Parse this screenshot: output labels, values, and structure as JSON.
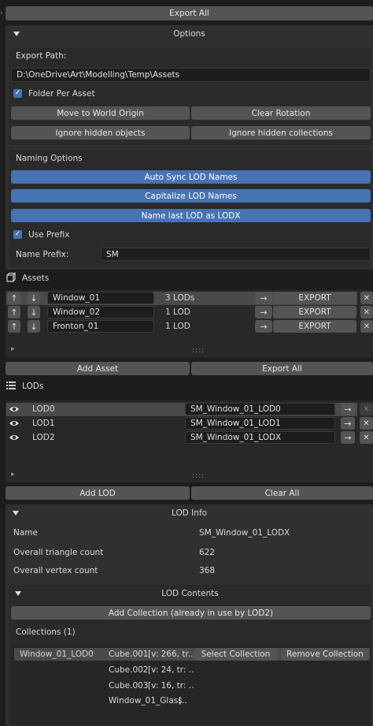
{
  "top": {
    "export_all": "Export All"
  },
  "options": {
    "title": "Options",
    "export_path_label": "Export Path:",
    "export_path_value": "D:\\OneDrive\\Art\\Modelling\\Temp\\Assets",
    "folder_per_asset": "Folder Per Asset",
    "move_to_world_origin": "Move to World Origin",
    "clear_rotation": "Clear Rotation",
    "ignore_hidden_objects": "Ignore hidden objects",
    "ignore_hidden_collections": "Ignore hidden collections",
    "naming_options": "Naming Options",
    "auto_sync": "Auto Sync LOD Names",
    "capitalize": "Capitalize LOD Names",
    "name_last_lod": "Name last LOD as LODX",
    "use_prefix": "Use Prefix",
    "name_prefix_label": "Name Prefix:",
    "name_prefix_value": "SM"
  },
  "assets": {
    "title": "Assets",
    "items": [
      {
        "name": "Window_01",
        "lods": "3 LODs",
        "export": "EXPORT"
      },
      {
        "name": "Window_02",
        "lods": "1 LOD",
        "export": "EXPORT"
      },
      {
        "name": "Fronton_01",
        "lods": "1 LOD",
        "export": "EXPORT"
      }
    ],
    "add_asset": "Add Asset",
    "export_all": "Export All"
  },
  "lods": {
    "title": "LODs",
    "items": [
      {
        "name": "LOD0",
        "mesh": "SM_Window_01_LOD0"
      },
      {
        "name": "LOD1",
        "mesh": "SM_Window_01_LOD1"
      },
      {
        "name": "LOD2",
        "mesh": "SM_Window_01_LODX"
      }
    ],
    "add_lod": "Add LOD",
    "clear_all": "Clear All"
  },
  "lod_info": {
    "title": "LOD Info",
    "name_label": "Name",
    "name_value": "SM_Window_01_LODX",
    "tri_label": "Overall triangle count",
    "tri_value": "622",
    "vert_label": "Overall vertex count",
    "vert_value": "368"
  },
  "lod_contents": {
    "title": "LOD Contents",
    "add_collection": "Add Collection (already in use by LOD2)",
    "collections_label": "Collections (1)",
    "collection_name": "Window_01_LOD0",
    "select_collection": "Select Collection",
    "remove_collection": "Remove Collection",
    "objects": [
      {
        "name": "Cube.001",
        "info": "[v: 266, tr..."
      },
      {
        "name": "Cube.002",
        "info": "[v: 24, tr: .."
      },
      {
        "name": "Cube.003",
        "info": "[v: 16, tr: .."
      },
      {
        "name": "Window_01_Glass",
        "info": "[.."
      }
    ]
  },
  "icons": {
    "up": "↑",
    "down": "↓",
    "arrow_right": "→",
    "close": "✕",
    "play": "▸",
    "grip": "::::"
  },
  "colors": {
    "accent": "#4772b3",
    "background": "#1d1d1d",
    "panel": "#303030",
    "button": "#545454"
  }
}
